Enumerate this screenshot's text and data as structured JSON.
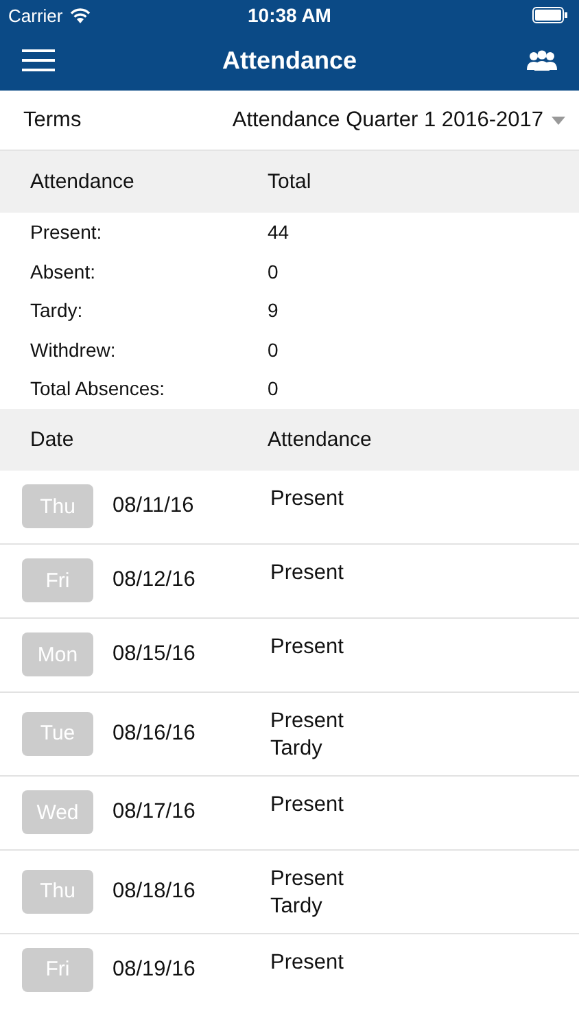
{
  "status_bar": {
    "carrier": "Carrier",
    "time": "10:38 AM"
  },
  "nav": {
    "title": "Attendance"
  },
  "terms": {
    "label": "Terms",
    "value": "Attendance Quarter 1 2016-2017"
  },
  "summary": {
    "columns": [
      "Attendance",
      "Total"
    ],
    "rows": [
      {
        "label": "Present:",
        "value": "44"
      },
      {
        "label": "Absent:",
        "value": "0"
      },
      {
        "label": "Tardy:",
        "value": "9"
      },
      {
        "label": "Withdrew:",
        "value": "0"
      },
      {
        "label": "Total Absences:",
        "value": "0"
      }
    ]
  },
  "days": {
    "columns": [
      "Date",
      "Attendance"
    ],
    "rows": [
      {
        "day": "Thu",
        "date": "08/11/16",
        "statuses": [
          "Present"
        ]
      },
      {
        "day": "Fri",
        "date": "08/12/16",
        "statuses": [
          "Present"
        ]
      },
      {
        "day": "Mon",
        "date": "08/15/16",
        "statuses": [
          "Present"
        ]
      },
      {
        "day": "Tue",
        "date": "08/16/16",
        "statuses": [
          "Present",
          "Tardy"
        ]
      },
      {
        "day": "Wed",
        "date": "08/17/16",
        "statuses": [
          "Present"
        ]
      },
      {
        "day": "Thu",
        "date": "08/18/16",
        "statuses": [
          "Present",
          "Tardy"
        ]
      },
      {
        "day": "Fri",
        "date": "08/19/16",
        "statuses": [
          "Present"
        ]
      }
    ]
  }
}
